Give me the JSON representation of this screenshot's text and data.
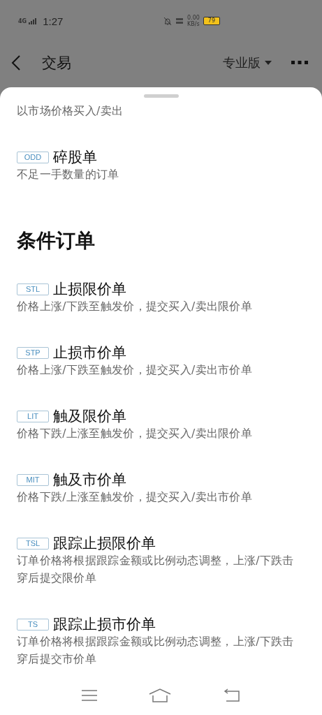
{
  "status_bar": {
    "network": "4G",
    "time": "1:27",
    "speed_value": "0.00",
    "speed_unit": "KB/s",
    "battery": "79"
  },
  "title_bar": {
    "title": "交易",
    "mode": "专业版"
  },
  "sheet": {
    "items": [
      {
        "kind": "note",
        "description": "以市场价格买入/卖出"
      },
      {
        "kind": "order",
        "tag": "ODD",
        "title": "碎股单",
        "description": "不足一手数量的订单"
      },
      {
        "kind": "heading",
        "text": "条件订单"
      },
      {
        "kind": "order",
        "tag": "STL",
        "title": "止损限价单",
        "description": "价格上涨/下跌至触发价，提交买入/卖出限价单"
      },
      {
        "kind": "order",
        "tag": "STP",
        "title": "止损市价单",
        "description": "价格上涨/下跌至触发价，提交买入/卖出市价单"
      },
      {
        "kind": "order",
        "tag": "LIT",
        "title": "触及限价单",
        "description": "价格下跌/上涨至触发价，提交买入/卖出限价单"
      },
      {
        "kind": "order",
        "tag": "MIT",
        "title": "触及市价单",
        "description": "价格下跌/上涨至触发价，提交买入/卖出市价单"
      },
      {
        "kind": "order",
        "tag": "TSL",
        "title": "跟踪止损限价单",
        "description": "订单价格将根据跟踪金额或比例动态调整，上涨/下跌击穿后提交限价单"
      },
      {
        "kind": "order",
        "tag": "TS",
        "title": "跟踪止损市价单",
        "description": "订单价格将根据跟踪金额或比例动态调整，上涨/下跌击穿后提交市价单"
      }
    ]
  }
}
